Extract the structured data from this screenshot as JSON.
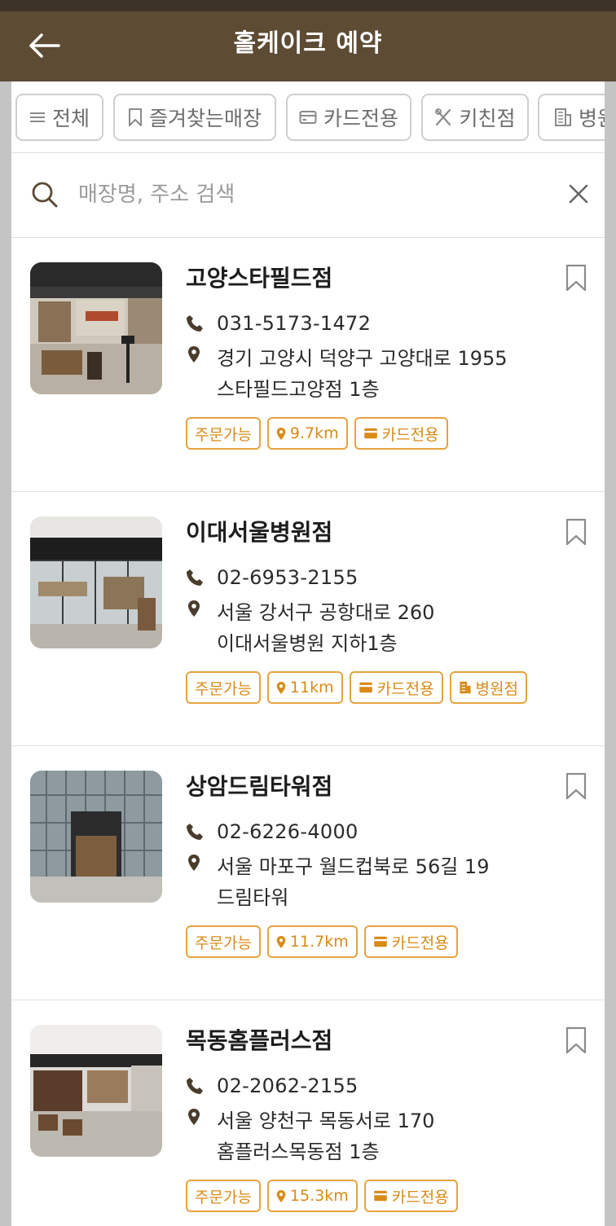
{
  "header": {
    "title": "홀케이크 예약",
    "back_icon": "arrow-left-icon"
  },
  "filters": [
    {
      "label": "전체",
      "icon": "menu-lines-icon"
    },
    {
      "label": "즐겨찾는매장",
      "icon": "bookmark-icon"
    },
    {
      "label": "카드전용",
      "icon": "card-icon"
    },
    {
      "label": "키친점",
      "icon": "utensils-icon"
    },
    {
      "label": "병원점",
      "icon": "hospital-building-icon"
    }
  ],
  "search": {
    "placeholder": "매장명, 주소 검색",
    "value": ""
  },
  "stores": [
    {
      "name": "고양스타필드점",
      "phone": "031-5173-1472",
      "address_line1": "경기 고양시 덕양구 고양대로 1955",
      "address_line2": "스타필드고양점 1층",
      "tags": {
        "order": "주문가능",
        "distance": "9.7km",
        "card": "카드전용"
      }
    },
    {
      "name": "이대서울병원점",
      "phone": "02-6953-2155",
      "address_line1": "서울 강서구 공항대로 260",
      "address_line2": "이대서울병원 지하1층",
      "tags": {
        "order": "주문가능",
        "distance": "11km",
        "card": "카드전용",
        "hospital": "병원점"
      }
    },
    {
      "name": "상암드림타워점",
      "phone": "02-6226-4000",
      "address_line1": "서울 마포구 월드컵북로 56길 19",
      "address_line2": "드림타워",
      "tags": {
        "order": "주문가능",
        "distance": "11.7km",
        "card": "카드전용"
      }
    },
    {
      "name": "목동홈플러스점",
      "phone": "02-2062-2155",
      "address_line1": "서울 양천구 목동서로 170",
      "address_line2": "홈플러스목동점 1층",
      "tags": {
        "order": "주문가능",
        "distance": "15.3km",
        "card": "카드전용"
      }
    }
  ],
  "colors": {
    "header_bg": "#5e4b34",
    "accent": "#e6a33e",
    "icon_brown": "#4a3c2c"
  }
}
